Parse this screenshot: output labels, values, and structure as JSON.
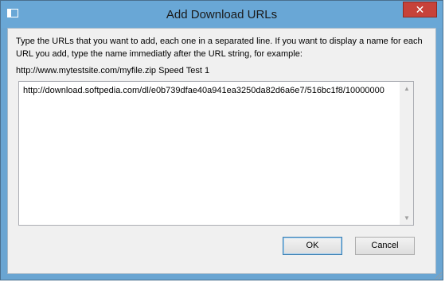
{
  "window": {
    "title": "Add Download URLs",
    "close_glyph": "✕"
  },
  "instructions": {
    "text": "Type the URLs that you want to add, each one in a separated line. If you want to display a name for each URL you add, type the name immediatly after the URL string, for example:",
    "example": "http://www.mytestsite.com/myfile.zip Speed Test 1"
  },
  "urls": {
    "value": "http://download.softpedia.com/dl/e0b739dfae40a941ea3250da82d6a6e7/516bc1f8/10000000"
  },
  "buttons": {
    "ok_label": "OK",
    "cancel_label": "Cancel"
  },
  "colors": {
    "titlebar": "#69a7d6",
    "close_button": "#c7423a",
    "client_background": "#f0f0f0"
  }
}
